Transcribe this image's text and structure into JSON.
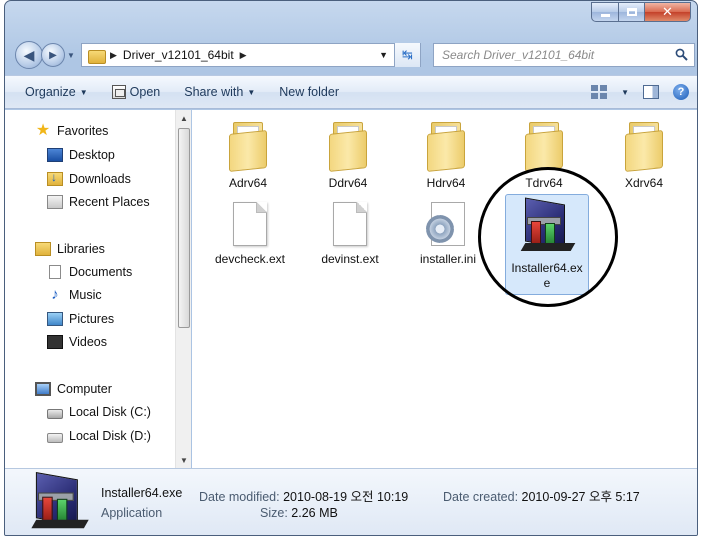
{
  "address": {
    "crumbs": [
      "Driver_v12101_64bit"
    ]
  },
  "search": {
    "placeholder": "Search Driver_v12101_64bit"
  },
  "toolbar": {
    "organize": "Organize",
    "open": "Open",
    "share_with": "Share with",
    "new_folder": "New folder"
  },
  "nav": {
    "favorites": "Favorites",
    "desktop": "Desktop",
    "downloads": "Downloads",
    "recent_places": "Recent Places",
    "libraries": "Libraries",
    "documents": "Documents",
    "music": "Music",
    "pictures": "Pictures",
    "videos": "Videos",
    "computer": "Computer",
    "local_disk_c": "Local Disk (C:)",
    "local_disk_d": "Local Disk (D:)"
  },
  "files": [
    {
      "name": "Adrv64",
      "type": "folder"
    },
    {
      "name": "Ddrv64",
      "type": "folder"
    },
    {
      "name": "Hdrv64",
      "type": "folder"
    },
    {
      "name": "Tdrv64",
      "type": "folder"
    },
    {
      "name": "Xdrv64",
      "type": "folder"
    },
    {
      "name": "devcheck.ext",
      "type": "document"
    },
    {
      "name": "devinst.ext",
      "type": "document"
    },
    {
      "name": "installer.ini",
      "type": "settings"
    },
    {
      "name": "Installer64.exe",
      "type": "application",
      "selected": true
    }
  ],
  "details": {
    "name": "Installer64.exe",
    "type": "Application",
    "date_modified_label": "Date modified:",
    "date_modified": "2010-08-19 오전 10:19",
    "date_created_label": "Date created:",
    "date_created": "2010-09-27 오후 5:17",
    "size_label": "Size:",
    "size": "2.26 MB"
  },
  "colors": {
    "selection": "#d6e8fb",
    "selection_border": "#84acdd",
    "window_frame": "#aec6e4"
  }
}
